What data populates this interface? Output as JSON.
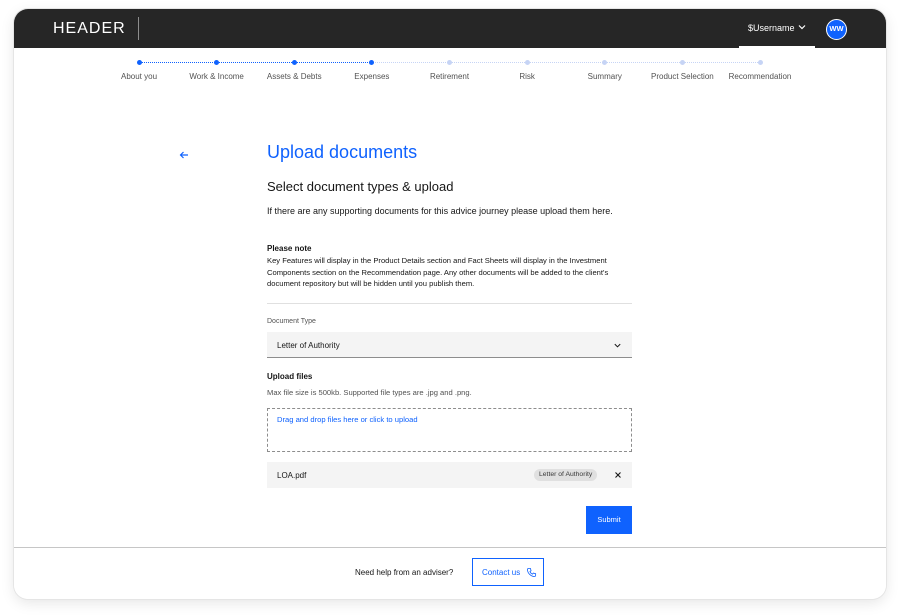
{
  "header": {
    "title": "HEADER",
    "username": "$Username",
    "avatar_initials": "WW",
    "chevron_icon": "chevron-down-icon"
  },
  "progress": {
    "completed_color": "#0f62fe",
    "pending_color": "#c6d4f5",
    "steps": [
      {
        "label": "About you",
        "status": "completed"
      },
      {
        "label": "Work & Income",
        "status": "completed"
      },
      {
        "label": "Assets & Debts",
        "status": "completed"
      },
      {
        "label": "Expenses",
        "status": "completed"
      },
      {
        "label": "Retirement",
        "status": "pending"
      },
      {
        "label": "Risk",
        "status": "pending"
      },
      {
        "label": "Summary",
        "status": "pending"
      },
      {
        "label": "Product Selection",
        "status": "pending"
      },
      {
        "label": "Recommendation",
        "status": "pending"
      }
    ]
  },
  "main": {
    "back_icon": "arrow-left-icon",
    "title": "Upload documents",
    "subtitle": "Select document types & upload",
    "intro": "If there are any supporting documents for this advice journey please upload them here.",
    "note_title": "Please note",
    "note_text": "Key Features will display in the Product Details section and Fact Sheets will display in the Investment Components section on the Recommendation page. Any other documents will be added to the client's document repository but will be hidden until you publish them.",
    "document_type": {
      "label": "Document Type",
      "value": "Letter of Authority"
    },
    "upload": {
      "title": "Upload files",
      "help": "Max file size is 500kb. Supported file types are .jpg and .png.",
      "dropzone_text": "Drag and drop files here or click to upload"
    },
    "file": {
      "name": "LOA.pdf",
      "tag": "Letter of Authority",
      "remove_icon": "close-icon"
    },
    "submit_label": "Submit"
  },
  "footer": {
    "help_text": "Need help from an adviser?",
    "contact_label": "Contact us",
    "contact_icon": "phone-icon"
  }
}
